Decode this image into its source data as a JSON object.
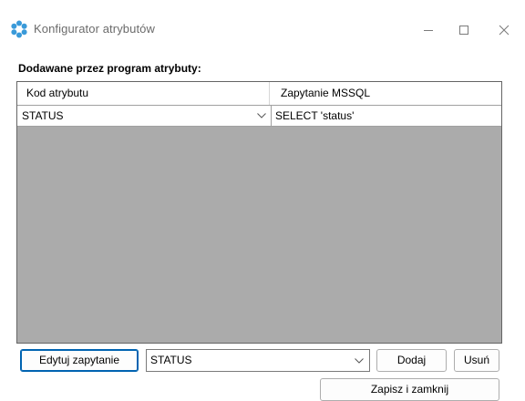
{
  "window": {
    "title": "Konfigurator atrybutów",
    "icon": "gear-flower-icon",
    "controls": [
      "minimize-icon",
      "maximize-icon",
      "close-icon"
    ]
  },
  "section": {
    "label": "Dodawane przez program atrybuty:"
  },
  "grid": {
    "columns": [
      "Kod atrybutu",
      "Zapytanie MSSQL"
    ],
    "rows": [
      {
        "code": "STATUS",
        "query": "SELECT 'status'"
      }
    ]
  },
  "controls": {
    "edit_button": "Edytuj zapytanie",
    "combo_value": "STATUS",
    "add_button": "Dodaj",
    "remove_button": "Usuń",
    "save_close_button": "Zapisz i zamknij"
  },
  "colors": {
    "accent": "#0063b1",
    "grid_background": "#ababab"
  }
}
